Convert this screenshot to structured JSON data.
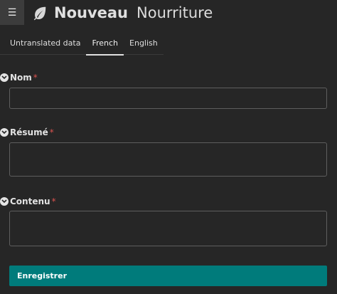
{
  "header": {
    "menu_icon": "hamburger-icon",
    "app_icon": "leaf-icon",
    "title": "Nouveau",
    "subtitle": "Nourriture"
  },
  "tabs": [
    {
      "label": "Untranslated data",
      "active": false
    },
    {
      "label": "French",
      "active": true
    },
    {
      "label": "English",
      "active": false
    }
  ],
  "fields": {
    "nom": {
      "label": "Nom",
      "required_mark": "*",
      "value": ""
    },
    "resume": {
      "label": "Résumé",
      "required_mark": "*",
      "value": ""
    },
    "contenu": {
      "label": "Contenu",
      "required_mark": "*",
      "value": ""
    }
  },
  "actions": {
    "save_label": "Enregistrer"
  },
  "colors": {
    "background": "#262626",
    "accent": "#007b7b",
    "required": "#d9534f",
    "input_border": "#5e5e5e"
  }
}
